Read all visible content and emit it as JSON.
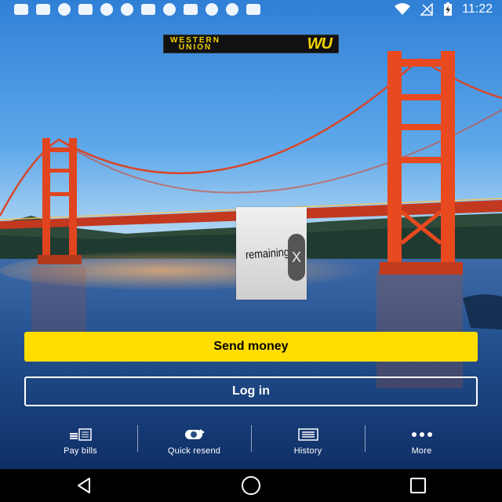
{
  "status_bar": {
    "time": "11:22",
    "notification_icons": [
      "message-icon",
      "cat-icon",
      "alarm-icon",
      "cat-icon",
      "alarm-icon",
      "alarm-icon",
      "cat-icon",
      "b-badge-icon",
      "mail-icon",
      "pinterest-icon",
      "dots-icon",
      "e-icon"
    ],
    "system_icons": [
      "wifi-icon",
      "no-signal-icon",
      "battery-charging-icon"
    ]
  },
  "brand": {
    "line1": "WESTERN",
    "line2": "UNION",
    "mark": "WU",
    "color": "#f6d400"
  },
  "ad": {
    "text": "remaining",
    "close_label": "X"
  },
  "buttons": {
    "send_money": "Send money",
    "log_in": "Log in",
    "accent": "#ffdd00"
  },
  "actions": [
    {
      "label": "Pay bills",
      "icon": "bill-icon"
    },
    {
      "label": "Quick resend",
      "icon": "money-resend-icon"
    },
    {
      "label": "History",
      "icon": "history-list-icon"
    },
    {
      "label": "More",
      "icon": "more-dots-icon"
    }
  ],
  "nav": [
    "back-icon",
    "home-icon",
    "recents-icon"
  ]
}
